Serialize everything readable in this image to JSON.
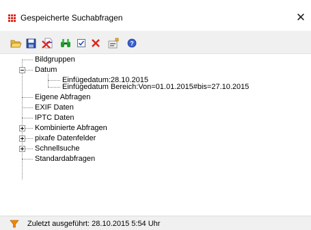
{
  "window": {
    "title": "Gespeicherte Suchabfragen",
    "close_symbol": "✕"
  },
  "toolbar": {
    "buttons": [
      {
        "name": "open-folder-icon"
      },
      {
        "name": "save-icon"
      },
      {
        "name": "delete-icon"
      },
      {
        "name": "search-binoculars-icon"
      },
      {
        "name": "checkbox-icon"
      },
      {
        "name": "remove-x-icon"
      },
      {
        "name": "properties-icon"
      },
      {
        "name": "help-icon"
      }
    ]
  },
  "tree": {
    "items": [
      {
        "label": "Bildgruppen"
      },
      {
        "label": "Datum",
        "children": [
          {
            "label": "Einfügedatum:28.10.2015"
          },
          {
            "label": "Einfügedatum Bereich:Von=01.01.2015#bis=27.10.2015"
          }
        ]
      },
      {
        "label": "Eigene Abfragen"
      },
      {
        "label": "EXIF Daten"
      },
      {
        "label": "IPTC Daten"
      },
      {
        "label": "Kombinierte Abfragen"
      },
      {
        "label": "pixafe Datenfelder"
      },
      {
        "label": "Schnellsuche"
      },
      {
        "label": "Standardabfragen"
      }
    ]
  },
  "status": {
    "text": "Zuletzt ausgeführt: 28.10.2015 5:54 Uhr",
    "icon": "funnel-icon"
  },
  "colors": {
    "accent_red": "#e0261b",
    "toolbar_bg": "#f0f0f0",
    "funnel_orange": "#f08a00"
  }
}
